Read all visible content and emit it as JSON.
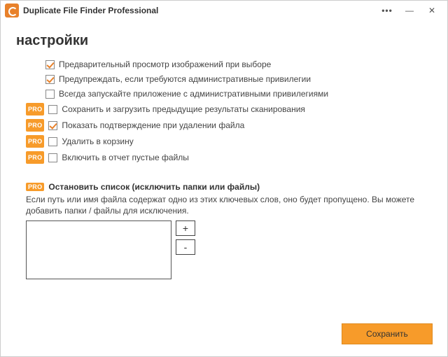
{
  "app": {
    "title": "Duplicate File Finder Professional"
  },
  "page": {
    "title": "настройки"
  },
  "badges": {
    "pro": "PRO"
  },
  "options": [
    {
      "label": "Предварительный просмотр изображений при выборе",
      "checked": true,
      "pro": false
    },
    {
      "label": "Предупреждать, если требуются административные привилегии",
      "checked": true,
      "pro": false
    },
    {
      "label": "Всегда запускайте приложение с административными привилегиями",
      "checked": false,
      "pro": false
    },
    {
      "label": "Сохранить и загрузить предыдущие результаты сканирования",
      "checked": false,
      "pro": true
    },
    {
      "label": "Показать подтверждение при удалении файла",
      "checked": true,
      "pro": true
    },
    {
      "label": "Удалить в корзину",
      "checked": false,
      "pro": true
    },
    {
      "label": "Включить в отчет пустые файлы",
      "checked": false,
      "pro": true
    }
  ],
  "stoplist": {
    "title": "Остановить список (исключить папки или файлы)",
    "desc": "Если путь или имя файла содержат одно из этих ключевых слов, оно будет пропущено. Вы можете добавить папки / файлы для исключения.",
    "add": "+",
    "remove": "-"
  },
  "footer": {
    "save": "Сохранить"
  }
}
